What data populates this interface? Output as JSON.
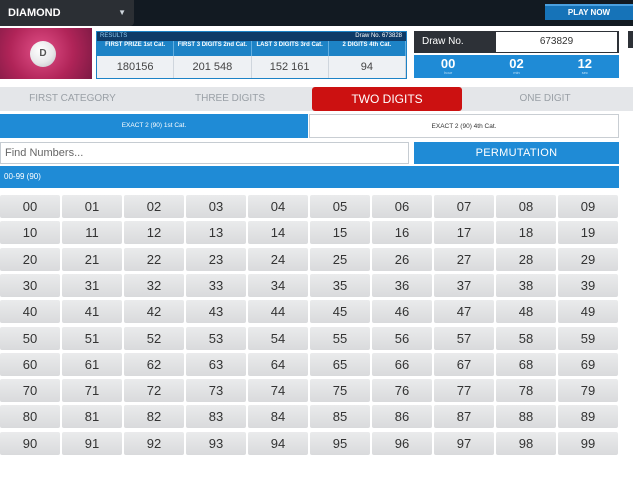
{
  "header": {
    "game_selected": "DIAMOND",
    "play_now_label": "PLAY NOW"
  },
  "logo": {
    "ball_letter": "D"
  },
  "results": {
    "label": "RESULTS",
    "draw_no_text": "Draw No. 673828",
    "columns": [
      {
        "head": "FIRST PRIZE 1st Cat.",
        "value": "180156"
      },
      {
        "head": "FIRST 3 DIGITS 2nd Cat.",
        "value": "201  548"
      },
      {
        "head": "LAST 3 DIGITS 3rd Cat.",
        "value": "152  161"
      },
      {
        "head": "2 DIGITS 4th Cat.",
        "value": "94"
      }
    ]
  },
  "draw": {
    "label": "Draw No.",
    "value": "673829",
    "timer": [
      {
        "value": "00",
        "unit": "hour"
      },
      {
        "value": "02",
        "unit": "min"
      },
      {
        "value": "12",
        "unit": "sec"
      }
    ]
  },
  "categories": [
    {
      "label": "FIRST CATEGORY",
      "active": false
    },
    {
      "label": "THREE DIGITS",
      "active": false
    },
    {
      "label": "TWO DIGITS",
      "active": true
    },
    {
      "label": "ONE DIGIT",
      "active": false
    }
  ],
  "subtabs": [
    {
      "label": "EXACT 2 (90) 1st Cat.",
      "active": true
    },
    {
      "label": "EXACT 2 (90) 4th Cat.",
      "active": false
    }
  ],
  "search": {
    "placeholder": "Find Numbers..."
  },
  "permutation_label": "PERMUTATION",
  "range_label": "00-99 (90)",
  "numbers": [
    "00",
    "01",
    "02",
    "03",
    "04",
    "05",
    "06",
    "07",
    "08",
    "09",
    "10",
    "11",
    "12",
    "13",
    "14",
    "15",
    "16",
    "17",
    "18",
    "19",
    "20",
    "21",
    "22",
    "23",
    "24",
    "25",
    "26",
    "27",
    "28",
    "29",
    "30",
    "31",
    "32",
    "33",
    "34",
    "35",
    "36",
    "37",
    "38",
    "39",
    "40",
    "41",
    "42",
    "43",
    "44",
    "45",
    "46",
    "47",
    "48",
    "49",
    "50",
    "51",
    "52",
    "53",
    "54",
    "55",
    "56",
    "57",
    "58",
    "59",
    "60",
    "61",
    "62",
    "63",
    "64",
    "65",
    "66",
    "67",
    "68",
    "69",
    "70",
    "71",
    "72",
    "73",
    "74",
    "75",
    "76",
    "77",
    "78",
    "79",
    "80",
    "81",
    "82",
    "83",
    "84",
    "85",
    "86",
    "87",
    "88",
    "89",
    "90",
    "91",
    "92",
    "93",
    "94",
    "95",
    "96",
    "97",
    "98",
    "99"
  ],
  "colors": {
    "accent_blue": "#1f8bd6",
    "active_red": "#cc1111",
    "dark_bar": "#121a22"
  }
}
